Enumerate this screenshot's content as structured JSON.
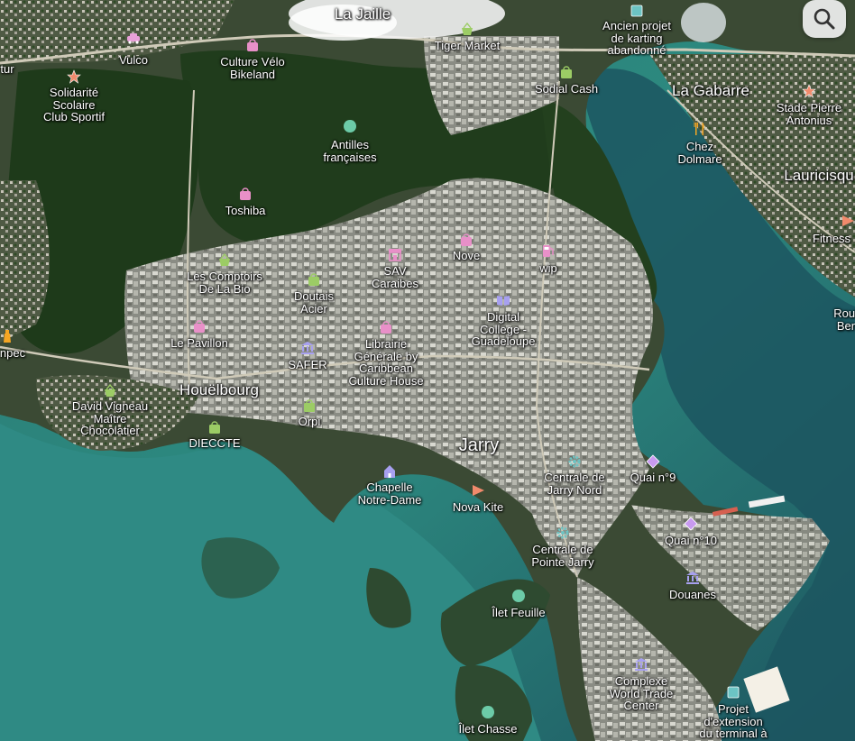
{
  "map": {
    "view": "satellite",
    "colors": {
      "sea_deep": "#1b4f57",
      "sea_shallow": "#2f8580",
      "reef": "#3f9e8e",
      "forest": "#1f3b1c",
      "urban": "#8d8f86",
      "road": "#c9c6b8"
    },
    "districts": [
      {
        "id": "la-jaille",
        "label": "La Jaille"
      },
      {
        "id": "la-gabarre",
        "label": "La Gabarre"
      },
      {
        "id": "houelbourg",
        "label": "Houëlbourg"
      },
      {
        "id": "jarry",
        "label": "Jarry"
      },
      {
        "id": "lauricisque",
        "label": "Lauricisqu"
      }
    ],
    "pois": [
      {
        "id": "vulco",
        "label": "Vulco",
        "icon": "car-icon",
        "color": "#e8a0d8"
      },
      {
        "id": "culture-velo",
        "label": "Culture Vélo\nBikeland",
        "icon": "shopping-bag-icon",
        "color": "#e890c8"
      },
      {
        "id": "tiger-market",
        "label": "Tiger Market",
        "icon": "basket-icon",
        "color": "#9ccc65"
      },
      {
        "id": "ancien-karting",
        "label": "Ancien projet\nde karting\nabandonné",
        "icon": "square-icon",
        "color": "#6cc4c4"
      },
      {
        "id": "sodial",
        "label": "Sodial Cash",
        "icon": "bag-icon",
        "color": "#9ccc65"
      },
      {
        "id": "solidarite",
        "label": "Solidarité\nScolaire\nClub Sportif",
        "icon": "star-icon",
        "color": "#f08a6c"
      },
      {
        "id": "tur",
        "label": "tur",
        "icon": "none",
        "color": ""
      },
      {
        "id": "antilles",
        "label": "Antilles\nfrançaises",
        "icon": "leaf-icon",
        "color": "#6ccba8"
      },
      {
        "id": "chez-dolmare",
        "label": "Chez\nDolmare",
        "icon": "fork-knife-icon",
        "color": "#f5a623"
      },
      {
        "id": "stade-pierre",
        "label": "Stade Pierre\nAntonius",
        "icon": "star-icon",
        "color": "#f08a6c"
      },
      {
        "id": "toshiba",
        "label": "Toshiba",
        "icon": "shopping-bag-icon",
        "color": "#e890c8"
      },
      {
        "id": "fitness",
        "label": "Fitness",
        "icon": "triangle-icon",
        "color": "#f08a6c"
      },
      {
        "id": "sav-caraibes",
        "label": "SAV\nCaraibes",
        "icon": "store-icon",
        "color": "#e890c8"
      },
      {
        "id": "nove",
        "label": "Nove",
        "icon": "shopping-bag-icon",
        "color": "#e890c8"
      },
      {
        "id": "wip",
        "label": "wip",
        "icon": "fuel-icon",
        "color": "#e890c8"
      },
      {
        "id": "comptoirs",
        "label": "Les Comptoirs\nDe La Bio",
        "icon": "basket-icon",
        "color": "#9ccc65"
      },
      {
        "id": "doutais",
        "label": "Doutais\nAcier",
        "icon": "bag-icon",
        "color": "#9ccc65"
      },
      {
        "id": "digital-college",
        "label": "Digital\nCollege -\nGuadeloupe",
        "icon": "book-icon",
        "color": "#a7a0f0"
      },
      {
        "id": "rout-ber",
        "label": "Rout\nBer",
        "icon": "none",
        "color": ""
      },
      {
        "id": "le-pavillon",
        "label": "Le Pavillon",
        "icon": "shopping-bag-icon",
        "color": "#e890c8"
      },
      {
        "id": "librairie",
        "label": "Librairie\nGénérale by\nCaribbean\nCulture House",
        "icon": "shopping-bag-icon",
        "color": "#e890c8"
      },
      {
        "id": "npec",
        "label": "npec",
        "icon": "bottle-icon",
        "color": "#f5a623"
      },
      {
        "id": "safer",
        "label": "SAFER",
        "icon": "bank-icon",
        "color": "#a7a0f0"
      },
      {
        "id": "david-vigneau",
        "label": "David Vigneau\nMaître\nChocolatier",
        "icon": "basket-icon",
        "color": "#9ccc65"
      },
      {
        "id": "orpi",
        "label": "Orpi",
        "icon": "bag-icon",
        "color": "#9ccc65"
      },
      {
        "id": "dieccte",
        "label": "DIECCTE",
        "icon": "bag-icon",
        "color": "#9ccc65"
      },
      {
        "id": "chapelle",
        "label": "Chapelle\nNotre-Dame",
        "icon": "church-icon",
        "color": "#a7a0f0"
      },
      {
        "id": "centrale-jarry-nord",
        "label": "Centrale de\nJarry Nord",
        "icon": "gear-icon",
        "color": "#6cc4c4"
      },
      {
        "id": "quai-9",
        "label": "Quai n°9",
        "icon": "diamond-icon",
        "color": "#c89af0"
      },
      {
        "id": "nova-kite",
        "label": "Nova Kite",
        "icon": "triangle-icon",
        "color": "#f08a6c"
      },
      {
        "id": "quai-10",
        "label": "Quai n°10",
        "icon": "diamond-icon",
        "color": "#c89af0"
      },
      {
        "id": "centrale-pointe-jarry",
        "label": "Centrale de\nPointe Jarry",
        "icon": "gear-icon",
        "color": "#6cc4c4"
      },
      {
        "id": "douanes",
        "label": "Douanes",
        "icon": "bank-icon",
        "color": "#a7a0f0"
      },
      {
        "id": "ilet-feuille",
        "label": "Îlet Feuille",
        "icon": "leaf-icon",
        "color": "#6ccba8"
      },
      {
        "id": "complexe-wtc",
        "label": "Complexe\nWorld Trade\nCenter",
        "icon": "bank-icon",
        "color": "#a7a0f0"
      },
      {
        "id": "projet-extension",
        "label": "Projet\nd'extension\ndu terminal à\nconteneurs",
        "icon": "square-icon",
        "color": "#6cc4c4"
      },
      {
        "id": "ilet-chasse",
        "label": "Îlet Chasse",
        "icon": "leaf-icon",
        "color": "#6ccba8"
      }
    ]
  },
  "controls": {
    "search_icon": "search-icon"
  }
}
